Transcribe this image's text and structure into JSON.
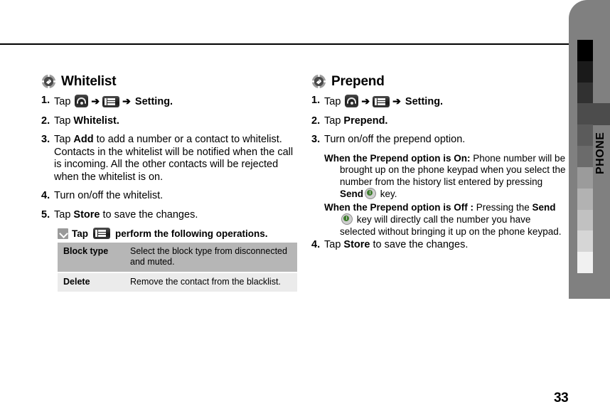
{
  "page": {
    "number": "33",
    "side_tab_label": "PHONE",
    "side_tab_blocks": [
      "#000000",
      "#1a1a1a",
      "#313131",
      "#4c4c4c",
      "#5b5b5b",
      "#6b6b6b",
      "#9b9b9b",
      "#b2b2b2",
      "#c1c1c1",
      "#d6d6d6",
      "#f1f1f1"
    ],
    "side_tab_active_index": 3,
    "side_tab_bg": "#808080"
  },
  "left_column": {
    "heading": "Whitelist",
    "heading_icon": "hand-tap-icon",
    "steps": [
      {
        "num": "1.",
        "parts": [
          {
            "type": "text",
            "text": "Tap "
          },
          {
            "type": "icon",
            "icon": "phone-app-icon"
          },
          {
            "type": "arrow",
            "text": "➔"
          },
          {
            "type": "icon",
            "icon": "menu-key-icon"
          },
          {
            "type": "arrow",
            "text": "➔"
          },
          {
            "type": "bold",
            "text": " Setting."
          }
        ]
      },
      {
        "num": "2.",
        "parts": [
          {
            "type": "text",
            "text": "Tap "
          },
          {
            "type": "bold",
            "text": "Whitelist."
          }
        ]
      },
      {
        "num": "3.",
        "parts": [
          {
            "type": "text",
            "text": "Tap "
          },
          {
            "type": "bold",
            "text": "Add"
          },
          {
            "type": "text",
            "text": " to add a number or a contact to whitelist. Contacts in the whitelist will be notified when the call is incoming. All the other contacts will be rejected when the whitelist is on."
          }
        ]
      },
      {
        "num": "4.",
        "parts": [
          {
            "type": "text",
            "text": "Turn on/off the whitelist."
          }
        ]
      },
      {
        "num": "5.",
        "parts": [
          {
            "type": "text",
            "text": "Tap "
          },
          {
            "type": "bold",
            "text": "Store"
          },
          {
            "type": "text",
            "text": " to save the changes."
          }
        ]
      }
    ],
    "subnote": {
      "icon": "arrow-down-left-icon",
      "prefix": "Tap",
      "chip": "menu-key-icon",
      "suffix": "perform the following operations."
    },
    "ops_table": {
      "rows": [
        {
          "key": "Block type",
          "value": "Select the block type from disconnected and muted.",
          "style": "dark"
        },
        {
          "key": "Delete",
          "value": "Remove the contact from the blacklist.",
          "style": "light"
        }
      ]
    }
  },
  "right_column": {
    "heading": "Prepend",
    "heading_icon": "hand-tap-icon",
    "steps": [
      {
        "num": "1.",
        "parts": [
          {
            "type": "text",
            "text": "Tap "
          },
          {
            "type": "icon",
            "icon": "phone-app-icon"
          },
          {
            "type": "arrow",
            "text": "➔"
          },
          {
            "type": "icon",
            "icon": "menu-key-icon"
          },
          {
            "type": "arrow",
            "text": "➔"
          },
          {
            "type": "bold",
            "text": " Setting."
          }
        ]
      },
      {
        "num": "2.",
        "parts": [
          {
            "type": "text",
            "text": "Tap "
          },
          {
            "type": "bold",
            "text": "Prepend."
          }
        ]
      },
      {
        "num": "3.",
        "parts": [
          {
            "type": "text",
            "text": "Turn on/off the prepend option."
          }
        ]
      }
    ],
    "definitions": [
      {
        "parts": [
          {
            "type": "bold",
            "text": "When the Prepend option is On:"
          },
          {
            "type": "text",
            "text": " Phone number will be brought up on the phone keypad when you select the number from the history list entered by pressing "
          },
          {
            "type": "bold",
            "text": "Send"
          },
          {
            "type": "icon",
            "icon": "send-key-icon"
          },
          {
            "type": "text",
            "text": " key."
          }
        ]
      },
      {
        "parts": [
          {
            "type": "bold",
            "text": "When the Prepend option is Off :"
          },
          {
            "type": "text",
            "text": " Pressing the "
          },
          {
            "type": "bold",
            "text": "Send"
          },
          {
            "type": "icon",
            "icon": "send-key-icon"
          },
          {
            "type": "text",
            "text": " key will directly call the number you have selected without bringing it up on the phone keypad."
          }
        ]
      }
    ],
    "final_step": {
      "num": "4.",
      "parts": [
        {
          "type": "text",
          "text": "Tap "
        },
        {
          "type": "bold",
          "text": "Store"
        },
        {
          "type": "text",
          "text": " to save the changes."
        }
      ]
    }
  }
}
